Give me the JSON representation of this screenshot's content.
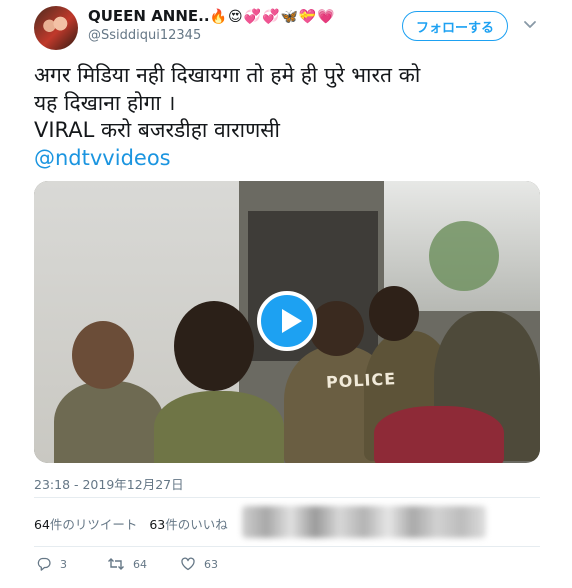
{
  "user": {
    "display_name": "QUEEN ANNE..",
    "emojis": "🔥😍💞💞🦋💝💗",
    "handle": "@Ssiddiqui12345",
    "follow_label": "フォローする"
  },
  "tweet": {
    "lines": [
      "अगर मिडिया नही दिखायगा तो हमे ही पुरे भारत को",
      "यह दिखाना होगा ।",
      "VIRAL करो बजरडीहा वाराणसी"
    ],
    "mention": "@ndtvvideos"
  },
  "media": {
    "type": "video",
    "overlay_text": "POLICE",
    "play_icon": "play-icon",
    "accent": "#1da1f2"
  },
  "meta": {
    "timestamp": "23:18 - 2019年12月27日"
  },
  "stats": {
    "retweets_count": "64",
    "retweets_label": "件のリツイート",
    "likes_count": "63",
    "likes_label": "件のいいね"
  },
  "actions": {
    "reply_count": "3",
    "retweet_count": "64",
    "like_count": "63"
  },
  "colors": {
    "link": "#1b95e0",
    "secondary_text": "#657786",
    "divider": "#e6ecf0"
  }
}
